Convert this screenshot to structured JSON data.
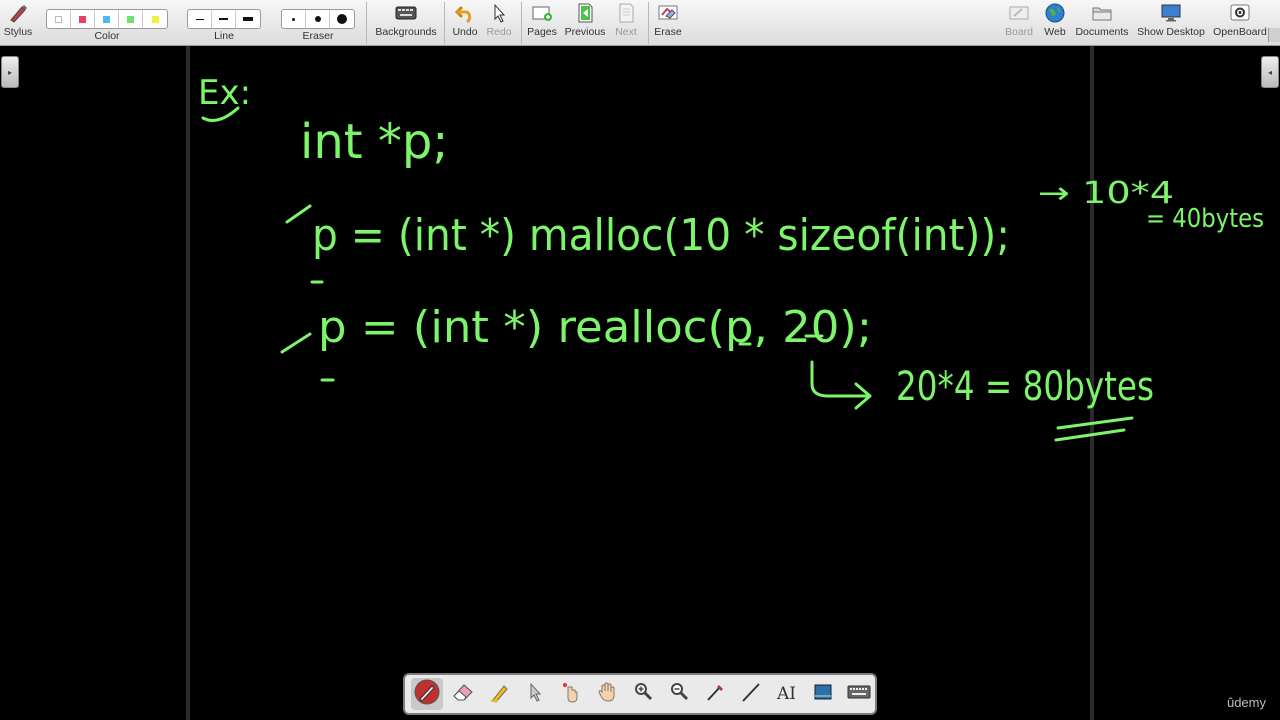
{
  "toolbar": {
    "stylus": "Stylus",
    "color": "Color",
    "line": "Line",
    "eraser": "Eraser",
    "backgrounds": "Backgrounds",
    "undo": "Undo",
    "redo": "Redo",
    "pages": "Pages",
    "previous": "Previous",
    "next": "Next",
    "erase": "Erase",
    "board": "Board",
    "web": "Web",
    "documents": "Documents",
    "show_desktop": "Show Desktop",
    "openboard": "OpenBoard",
    "palette_colors": [
      "#ffffff",
      "#e84060",
      "#50b8f0",
      "#70e070",
      "#f0f040"
    ],
    "icons": [
      "stylus-icon",
      "keyboard-icon",
      "undo-icon",
      "redo-icon",
      "add-page-icon",
      "previous-page-icon",
      "next-page-icon",
      "erase-board-icon",
      "board-icon",
      "globe-icon",
      "folder-icon",
      "monitor-icon",
      "gear-icon"
    ]
  },
  "board": {
    "ink_color": "#7cf56a",
    "lines": [
      "Ex:",
      "int *p;",
      "p = (int *) malloc(10 * sizeof(int));",
      "→ 10*4",
      "= 40bytes",
      "p = (int *) realloc(p, 20);",
      "20*4 = 80bytes"
    ]
  },
  "dock": {
    "icons": [
      "pen-icon",
      "eraser-icon",
      "highlighter-icon",
      "pointer-icon",
      "laser-pointer-icon",
      "hand-icon",
      "zoom-in-icon",
      "zoom-out-icon",
      "line-icon",
      "ruler-line-icon",
      "text-tool-icon",
      "capture-icon",
      "virtual-keyboard-icon"
    ]
  },
  "brand": "ûdemy"
}
